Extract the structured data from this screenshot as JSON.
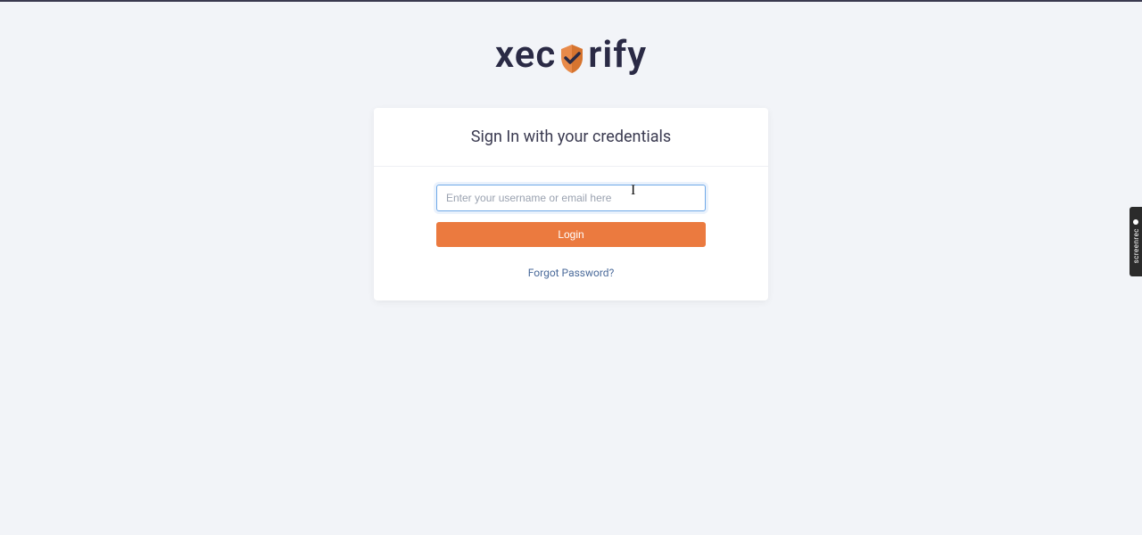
{
  "logo": {
    "text_left": "xec",
    "text_right": "rify"
  },
  "card": {
    "title": "Sign In with your credentials",
    "username": {
      "value": "",
      "placeholder": "Enter your username or email here"
    },
    "login_label": "Login",
    "forgot_label": "Forgot Password?"
  },
  "side_widget": {
    "label": "screenrec"
  },
  "colors": {
    "accent": "#eb7a3f",
    "link": "#4a6a9a",
    "border_focus": "#6fa9e8",
    "background": "#f2f4f8"
  }
}
